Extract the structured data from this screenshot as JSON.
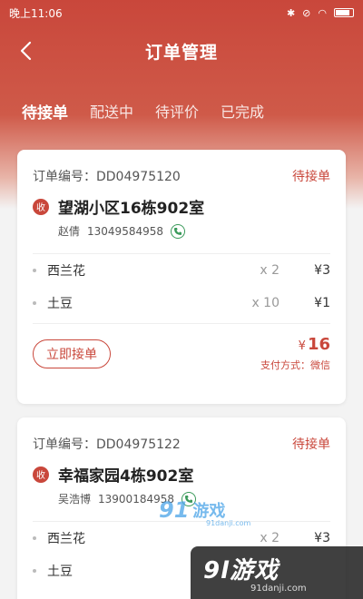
{
  "status_bar": {
    "time": "晚上11:06"
  },
  "nav": {
    "title": "订单管理"
  },
  "tabs": [
    {
      "label": "待接单",
      "active": true
    },
    {
      "label": "配送中",
      "active": false
    },
    {
      "label": "待评价",
      "active": false
    },
    {
      "label": "已完成",
      "active": false
    }
  ],
  "orders": [
    {
      "order_no": "订单编号：DD04975120",
      "status": "待接单",
      "badge": "收",
      "address": "望湖小区16栋902室",
      "contact_name": "赵倩",
      "contact_phone": "13049584958",
      "items": [
        {
          "name": "西兰花",
          "qty": "x 2",
          "price": "¥3"
        },
        {
          "name": "土豆",
          "qty": "x 10",
          "price": "¥1"
        }
      ],
      "accept_label": "立即接单",
      "total_currency": "¥",
      "total_amount": "16",
      "payment": "支付方式：微信"
    },
    {
      "order_no": "订单编号：DD04975122",
      "status": "待接单",
      "badge": "收",
      "address": "幸福家园4栋902室",
      "contact_name": "吴浩博",
      "contact_phone": "13900184958",
      "items": [
        {
          "name": "西兰花",
          "qty": "x 2",
          "price": "¥3"
        },
        {
          "name": "土豆",
          "qty": "",
          "price": ""
        }
      ]
    }
  ],
  "watermark": {
    "center_logo": "91",
    "center_text": "游戏",
    "center_url": "91danji.com",
    "corner_text": "9l游戏",
    "corner_url": "91danji.com"
  },
  "colors": {
    "accent": "#c9473b",
    "phone_green": "#3a9a5a"
  }
}
